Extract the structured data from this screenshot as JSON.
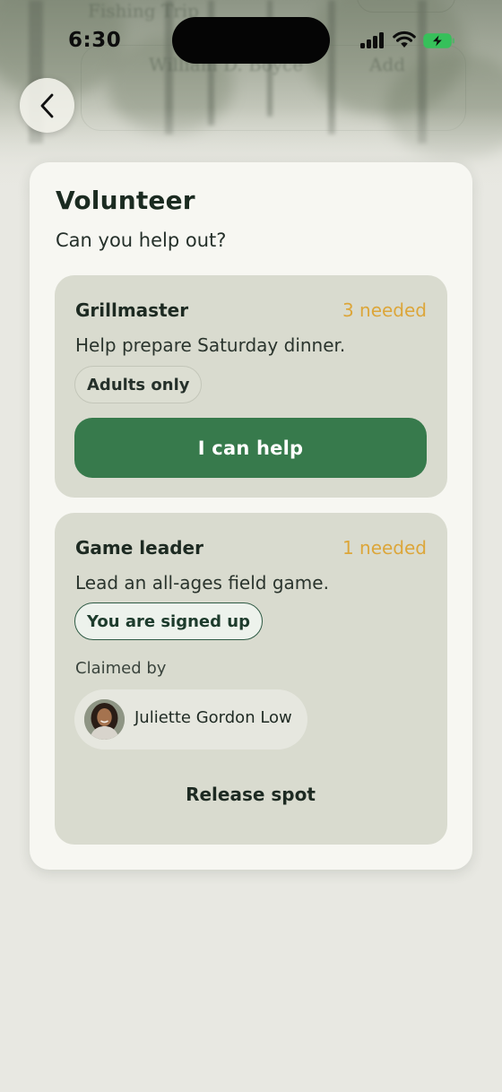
{
  "status_bar": {
    "time": "6:30",
    "icons": [
      "cellular-signal-icon",
      "wifi-icon",
      "battery-charging-icon"
    ]
  },
  "backdrop": {
    "ghost_lines": [
      "Fishing Trip",
      "William D. Boyce",
      "Add"
    ]
  },
  "nav": {
    "back_icon": "chevron-left-icon"
  },
  "volunteer": {
    "title": "Volunteer",
    "subtitle": "Can you help out?",
    "roles": [
      {
        "name": "Grillmaster",
        "needed": "3 needed",
        "description": "Help prepare Saturday dinner.",
        "tag": "Adults only",
        "action_label": "I can help"
      },
      {
        "name": "Game leader",
        "needed": "1 needed",
        "description": "Lead an all-ages field game.",
        "tag": "You are signed up",
        "claimed_label": "Claimed by",
        "claimed_by": "Juliette Gordon Low",
        "action_label": "Release spot"
      }
    ]
  },
  "colors": {
    "accent_green": "#377a4c",
    "needed_amber": "#dca63a",
    "card_bg": "#f7f7f2",
    "role_bg": "#d9dbcf"
  }
}
